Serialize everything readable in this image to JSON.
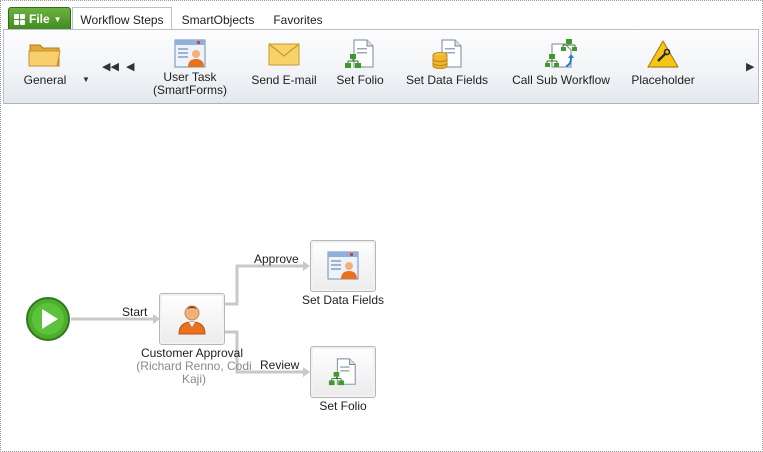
{
  "tabs": {
    "file_label": "File",
    "workflow_steps": "Workflow Steps",
    "smartobjects": "SmartObjects",
    "favorites": "Favorites",
    "active": "Workflow Steps"
  },
  "ribbon": {
    "general": "General",
    "user_task_line1": "User Task",
    "user_task_line2": "(SmartForms)",
    "send_email": "Send E-mail",
    "set_folio": "Set Folio",
    "set_data_fields": "Set Data Fields",
    "call_sub_workflow": "Call Sub Workflow",
    "placeholder": "Placeholder"
  },
  "canvas": {
    "start_line_label": "Start",
    "approve_line_label": "Approve",
    "review_line_label": "Review",
    "customer_approval": "Customer Approval",
    "customer_approval_sub": "(Richard Renno, Codi Kaji)",
    "set_data_fields_node": "Set Data Fields",
    "set_folio_node": "Set Folio"
  },
  "colors": {
    "file_green": "#4e9a26",
    "start_green": "#4cae2c",
    "connector_gray": "#c8c8c8",
    "user_orange": "#e8711e"
  }
}
